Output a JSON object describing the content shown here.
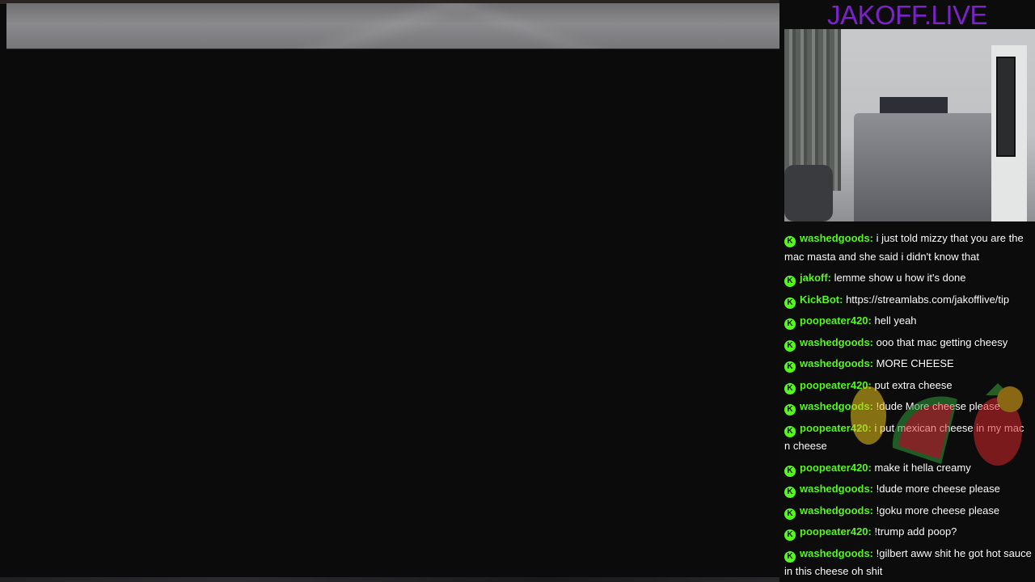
{
  "brand": {
    "title": "JAKOFF.LIVE",
    "color": "#7c22c8"
  },
  "colors": {
    "kick_green": "#53fc18",
    "message_text": "#ffffff",
    "background": "#0c0c0c"
  },
  "chat": {
    "badge_icon": "kick-icon",
    "badge_glyph": "K",
    "messages": [
      {
        "user": "washedgoods:",
        "text": "i just told mizzy that you are the mac masta and she said i didn't know that"
      },
      {
        "user": "jakoff:",
        "text": "lemme show u how it's done"
      },
      {
        "user": "KickBot:",
        "text": "https://streamlabs.com/jakofflive/tip"
      },
      {
        "user": "poopeater420:",
        "text": "hell yeah"
      },
      {
        "user": "washedgoods:",
        "text": "ooo that mac getting cheesy"
      },
      {
        "user": "washedgoods:",
        "text": "MORE CHEESE"
      },
      {
        "user": "poopeater420:",
        "text": "put extra cheese"
      },
      {
        "user": "washedgoods:",
        "text": "!dude More cheese please"
      },
      {
        "user": "poopeater420:",
        "text": "i put mexican cheese in my mac n cheese"
      },
      {
        "user": "poopeater420:",
        "text": "make it hella creamy"
      },
      {
        "user": "washedgoods:",
        "text": "!dude more cheese please"
      },
      {
        "user": "washedgoods:",
        "text": "!goku more cheese please"
      },
      {
        "user": "poopeater420:",
        "text": "!trump add poop?"
      },
      {
        "user": "washedgoods:",
        "text": "!gilbert aww shit he got hot sauce in this cheese oh shit"
      }
    ]
  }
}
